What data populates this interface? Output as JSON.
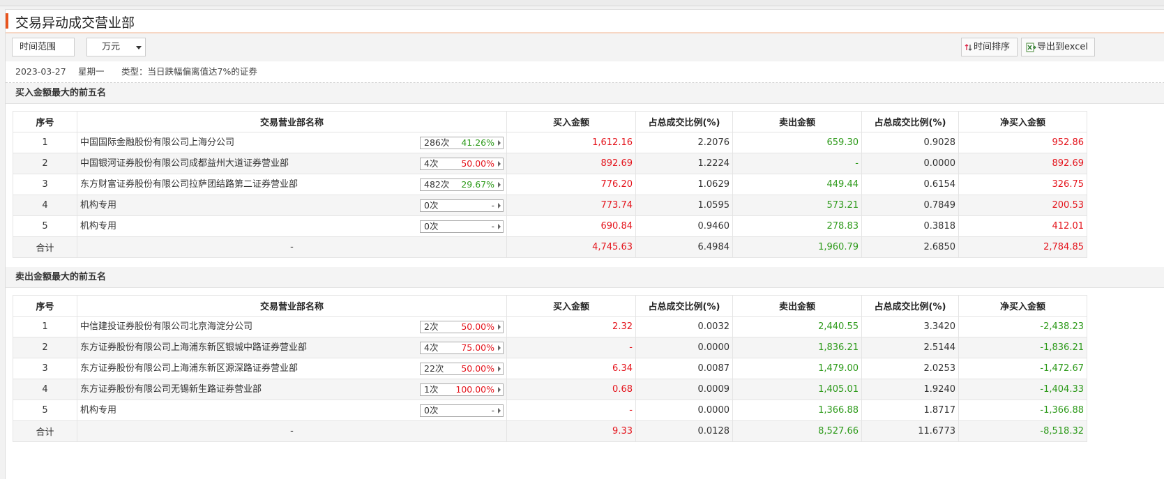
{
  "page": {
    "title": "交易异动成交营业部"
  },
  "toolbar": {
    "range_label": "时间范围",
    "unit_label": "万元",
    "sort_label": "时间排序",
    "export_label": "导出到excel"
  },
  "info": {
    "date": "2023-03-27",
    "weekday": "星期一",
    "type_text": "类型：当日跌幅偏离值达7%的证券"
  },
  "columns": [
    "序号",
    "交易营业部名称",
    "买入金额",
    "占总成交比例(%)",
    "卖出金额",
    "占总成交比例(%)",
    "净买入金额"
  ],
  "colors": {
    "up": "#e4131b",
    "down": "#2d9a1a",
    "accent": "#e8541e"
  },
  "buy_section": {
    "title": "买入金额最大的前五名",
    "rows": [
      {
        "idx": "1",
        "name": "中国国际金融股份有限公司上海分公司",
        "count": "286次",
        "rate": "41.26%",
        "rate_color": "green",
        "buy": "1,612.16",
        "buy_pct": "2.2076",
        "sell": "659.30",
        "sell_pct": "0.9028",
        "net": "952.86",
        "net_color": "red"
      },
      {
        "idx": "2",
        "name": "中国银河证券股份有限公司成都益州大道证券营业部",
        "count": "4次",
        "rate": "50.00%",
        "rate_color": "red",
        "buy": "892.69",
        "buy_pct": "1.2224",
        "sell": "-",
        "sell_pct": "0.0000",
        "net": "892.69",
        "net_color": "red"
      },
      {
        "idx": "3",
        "name": "东方财富证券股份有限公司拉萨团结路第二证券营业部",
        "count": "482次",
        "rate": "29.67%",
        "rate_color": "green",
        "buy": "776.20",
        "buy_pct": "1.0629",
        "sell": "449.44",
        "sell_pct": "0.6154",
        "net": "326.75",
        "net_color": "red"
      },
      {
        "idx": "4",
        "name": "机构专用",
        "count": "0次",
        "rate": "-",
        "rate_color": "gray",
        "buy": "773.74",
        "buy_pct": "1.0595",
        "sell": "573.21",
        "sell_pct": "0.7849",
        "net": "200.53",
        "net_color": "red"
      },
      {
        "idx": "5",
        "name": "机构专用",
        "count": "0次",
        "rate": "-",
        "rate_color": "gray",
        "buy": "690.84",
        "buy_pct": "0.9460",
        "sell": "278.83",
        "sell_pct": "0.3818",
        "net": "412.01",
        "net_color": "red"
      }
    ],
    "total": {
      "label": "合计",
      "name": "-",
      "buy": "4,745.63",
      "buy_pct": "6.4984",
      "sell": "1,960.79",
      "sell_pct": "2.6850",
      "net": "2,784.85",
      "net_color": "red"
    }
  },
  "sell_section": {
    "title": "卖出金额最大的前五名",
    "rows": [
      {
        "idx": "1",
        "name": "中信建投证券股份有限公司北京海淀分公司",
        "count": "2次",
        "rate": "50.00%",
        "rate_color": "red",
        "buy": "2.32",
        "buy_pct": "0.0032",
        "sell": "2,440.55",
        "sell_pct": "3.3420",
        "net": "-2,438.23",
        "net_color": "green"
      },
      {
        "idx": "2",
        "name": "东方证券股份有限公司上海浦东新区银城中路证券营业部",
        "count": "4次",
        "rate": "75.00%",
        "rate_color": "red",
        "buy": "-",
        "buy_pct": "0.0000",
        "sell": "1,836.21",
        "sell_pct": "2.5144",
        "net": "-1,836.21",
        "net_color": "green"
      },
      {
        "idx": "3",
        "name": "东方证券股份有限公司上海浦东新区源深路证券营业部",
        "count": "22次",
        "rate": "50.00%",
        "rate_color": "red",
        "buy": "6.34",
        "buy_pct": "0.0087",
        "sell": "1,479.00",
        "sell_pct": "2.0253",
        "net": "-1,472.67",
        "net_color": "green"
      },
      {
        "idx": "4",
        "name": "东方证券股份有限公司无锡新生路证券营业部",
        "count": "1次",
        "rate": "100.00%",
        "rate_color": "red",
        "buy": "0.68",
        "buy_pct": "0.0009",
        "sell": "1,405.01",
        "sell_pct": "1.9240",
        "net": "-1,404.33",
        "net_color": "green"
      },
      {
        "idx": "5",
        "name": "机构专用",
        "count": "0次",
        "rate": "-",
        "rate_color": "gray",
        "buy": "-",
        "buy_pct": "0.0000",
        "sell": "1,366.88",
        "sell_pct": "1.8717",
        "net": "-1,366.88",
        "net_color": "green"
      }
    ],
    "total": {
      "label": "合计",
      "name": "-",
      "buy": "9.33",
      "buy_pct": "0.0128",
      "sell": "8,527.66",
      "sell_pct": "11.6773",
      "net": "-8,518.32",
      "net_color": "green"
    }
  }
}
